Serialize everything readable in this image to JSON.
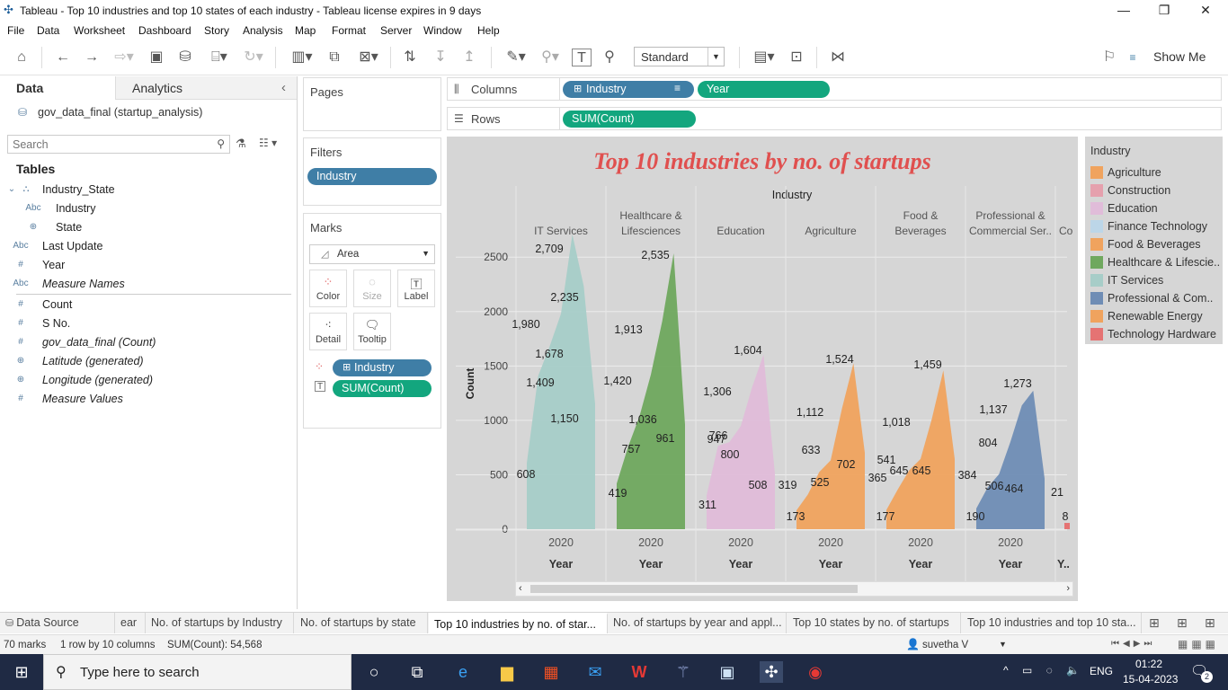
{
  "window": {
    "title": "Tableau - Top 10 industries and top 10 states of each industry - Tableau license expires in 9 days",
    "minimize": "—",
    "restore": "❐",
    "close": "✕"
  },
  "menu": [
    "File",
    "Data",
    "Worksheet",
    "Dashboard",
    "Story",
    "Analysis",
    "Map",
    "Format",
    "Server",
    "Window",
    "Help"
  ],
  "toolbar": {
    "fit_select": "Standard",
    "show_me": "Show Me"
  },
  "data_pane": {
    "tab_data": "Data",
    "tab_analytics": "Analytics",
    "collapse": "‹",
    "datasource": "gov_data_final (startup_analysis)",
    "search_placeholder": "Search",
    "tables_heading": "Tables",
    "fields": [
      {
        "icon": "⌄",
        "type": "",
        "label": "Industry_State",
        "italic": false,
        "indent": 0
      },
      {
        "icon": "Abc",
        "type": "",
        "label": "Industry",
        "italic": false,
        "indent": 1
      },
      {
        "icon": "⊕",
        "type": "",
        "label": "State",
        "italic": false,
        "indent": 1
      },
      {
        "icon": "Abc",
        "type": "",
        "label": "Last Update",
        "italic": false,
        "indent": 0
      },
      {
        "icon": "#",
        "type": "",
        "label": "Year",
        "italic": false,
        "indent": 0
      },
      {
        "icon": "Abc",
        "type": "",
        "label": "Measure Names",
        "italic": true,
        "indent": 0
      },
      {
        "icon": "#",
        "type": "",
        "label": "Count",
        "italic": false,
        "indent": 0
      },
      {
        "icon": "#",
        "type": "",
        "label": "S No.",
        "italic": false,
        "indent": 0
      },
      {
        "icon": "#",
        "type": "",
        "label": "gov_data_final (Count)",
        "italic": true,
        "indent": 0
      },
      {
        "icon": "⊕",
        "type": "",
        "label": "Latitude (generated)",
        "italic": true,
        "indent": 0
      },
      {
        "icon": "⊕",
        "type": "",
        "label": "Longitude (generated)",
        "italic": true,
        "indent": 0
      },
      {
        "icon": "#",
        "type": "",
        "label": "Measure Values",
        "italic": true,
        "indent": 0
      }
    ]
  },
  "shelves": {
    "pages": "Pages",
    "filters": "Filters",
    "filter_pill": "Industry",
    "marks": "Marks",
    "mark_type": "Area",
    "mark_buttons": [
      "Color",
      "Size",
      "Label",
      "Detail",
      "Tooltip"
    ],
    "mark_pills": [
      "Industry",
      "SUM(Count)"
    ],
    "columns_label": "Columns",
    "rows_label": "Rows",
    "columns_pills": [
      "Industry",
      "Year"
    ],
    "rows_pills": [
      "SUM(Count)"
    ]
  },
  "legend": {
    "title": "Industry",
    "items": [
      {
        "label": "Agriculture",
        "color": "#f0a35e"
      },
      {
        "label": "Construction",
        "color": "#e5a0ad"
      },
      {
        "label": "Education",
        "color": "#e0bcd9"
      },
      {
        "label": "Finance Technology",
        "color": "#bcd6e8"
      },
      {
        "label": "Food & Beverages",
        "color": "#f0a35e"
      },
      {
        "label": "Healthcare & Lifescie..",
        "color": "#6fa85e"
      },
      {
        "label": "IT Services",
        "color": "#a7cdc8"
      },
      {
        "label": "Professional & Com..",
        "color": "#6f8db5"
      },
      {
        "label": "Renewable Energy",
        "color": "#f0a35e"
      },
      {
        "label": "Technology Hardware",
        "color": "#e57373"
      }
    ]
  },
  "chart_data": {
    "type": "area",
    "title": "Top 10 industries by no. of startups",
    "column_header": "Industry",
    "ylabel": "Count",
    "ylim": [
      0,
      2700
    ],
    "yticks": [
      0,
      500,
      1000,
      1500,
      2000,
      2500
    ],
    "grid": true,
    "panes": [
      {
        "header": "IT Services",
        "header2": "",
        "year": "2020",
        "year_title": "Year",
        "color": "#a7cdc8",
        "values": [
          608,
          1409,
          1678,
          1980,
          2709,
          2235,
          1150
        ],
        "labels": [
          "608",
          "1,409",
          "1,678",
          "1,980",
          "2,709",
          "2,235",
          "1,150"
        ]
      },
      {
        "header": "Healthcare &",
        "header2": "Lifesciences",
        "year": "2020",
        "year_title": "Year",
        "color": "#6fa85e",
        "values": [
          419,
          757,
          1036,
          1420,
          1913,
          2535,
          961
        ],
        "labels": [
          "419",
          "757",
          "1,036",
          "1,420",
          "1,913",
          "2,535",
          "961"
        ]
      },
      {
        "header": "Education",
        "header2": "",
        "year": "2020",
        "year_title": "Year",
        "color": "#e0bcd9",
        "values": [
          311,
          766,
          800,
          947,
          1306,
          1604,
          508
        ],
        "labels": [
          "311",
          "766",
          "800",
          "947",
          "1,306",
          "1,604",
          "508"
        ]
      },
      {
        "header": "Agriculture",
        "header2": "",
        "year": "2020",
        "year_title": "Year",
        "color": "#f0a35e",
        "values": [
          173,
          319,
          525,
          633,
          1112,
          1524,
          702
        ],
        "labels": [
          "173",
          "319",
          "525",
          "633",
          "1,112",
          "1,524",
          "702"
        ]
      },
      {
        "header": "Food &",
        "header2": "Beverages",
        "year": "2020",
        "year_title": "Year",
        "color": "#f0a35e",
        "values": [
          177,
          365,
          541,
          645,
          1018,
          1459,
          645
        ],
        "labels": [
          "177",
          "365",
          "541",
          "645",
          "1,018",
          "1,459",
          "645"
        ]
      },
      {
        "header": "Professional &",
        "header2": "Commercial Ser..",
        "year": "2020",
        "year_title": "Year",
        "color": "#6f8db5",
        "values": [
          190,
          384,
          506,
          804,
          1137,
          1273,
          464
        ],
        "labels": [
          "190",
          "384",
          "506",
          "804",
          "1,137",
          "1,273",
          "464"
        ]
      },
      {
        "header": "Co",
        "header2": "",
        "year": "",
        "year_title": "Y..",
        "color": "#e57373",
        "values": [
          8,
          21
        ],
        "labels": [
          "8",
          "21"
        ]
      }
    ]
  },
  "sheet_tabs": {
    "data_source": "Data Source",
    "tabs": [
      "ear",
      "No. of startups by Industry",
      "No. of startups by state",
      "Top 10 industries by no. of star...",
      "No. of startups by year and appl...",
      "Top 10 states by no. of startups",
      "Top 10 industries and top 10 sta..."
    ],
    "active_index": 3
  },
  "status": {
    "marks": "70 marks",
    "rows_cols": "1 row by 10 columns",
    "sum": "SUM(Count): 54,568",
    "user": "suvetha V"
  },
  "taskbar": {
    "search_placeholder": "Type here to search",
    "lang": "ENG",
    "time": "01:22",
    "date": "15-04-2023",
    "notif_count": "2"
  }
}
